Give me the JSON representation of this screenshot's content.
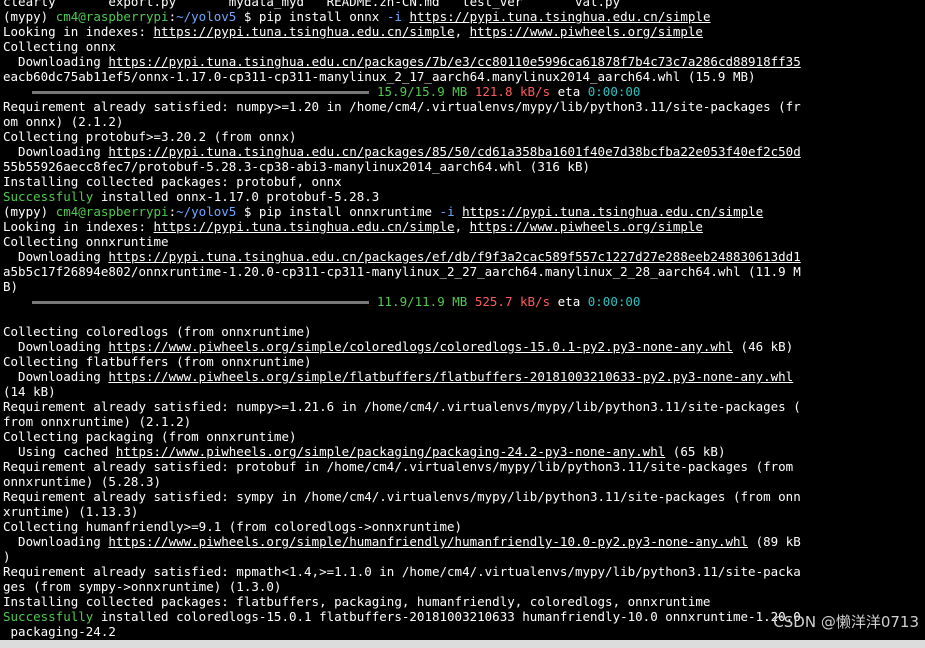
{
  "prompt": {
    "env": "(mypy)",
    "user_host": "cm4@raspberrypi",
    "path": "~/yolov5",
    "symbol": "$"
  },
  "top_partial": "clearly       export.py       mydata_myd   README.zh-CN.md   test_ver       val.py",
  "cmd1": {
    "text": "pip install onnx",
    "flag": "-i",
    "url": "https://pypi.tuna.tsinghua.edu.cn/simple"
  },
  "idx1": {
    "label": "Looking in indexes:",
    "url1": "https://pypi.tuna.tsinghua.edu.cn/simple",
    "url2": "https://www.piwheels.org/simple"
  },
  "l4": "Collecting onnx",
  "dl1": {
    "label": "  Downloading",
    "url": "https://pypi.tuna.tsinghua.edu.cn/packages/7b/e3/cc80110e5996ca61878f7b4c73c7a286cd88918ff35",
    "cont": "eacb60dc75ab11ef5/onnx-1.17.0-cp311-cp311-manylinux_2_17_aarch64.manylinux2014_aarch64.whl (15.9 MB)"
  },
  "prog1": {
    "size": "15.9/15.9 MB",
    "speed": "121.8 kB/s",
    "eta_label": "eta",
    "eta": "0:00:00"
  },
  "l8": "Requirement already satisfied: numpy>=1.20 in /home/cm4/.virtualenvs/mypy/lib/python3.11/site-packages (fr",
  "l9": "om onnx) (2.1.2)",
  "l10": "Collecting protobuf>=3.20.2 (from onnx)",
  "dl2": {
    "label": "  Downloading",
    "url": "https://pypi.tuna.tsinghua.edu.cn/packages/85/50/cd61a358ba1601f40e7d38bcfba22e053f40ef2c50d",
    "cont": "55b55926aecc8fec7/protobuf-5.28.3-cp38-abi3-manylinux2014_aarch64.whl (316 kB)"
  },
  "l13": "Installing collected packages: protobuf, onnx",
  "succ1": {
    "word": "Successfully",
    "rest": " installed onnx-1.17.0 protobuf-5.28.3"
  },
  "cmd2": {
    "text": "pip install onnxruntime",
    "flag": "-i",
    "url": "https://pypi.tuna.tsinghua.edu.cn/simple"
  },
  "l17": "Collecting onnxruntime",
  "dl3": {
    "label": "  Downloading",
    "url": "https://pypi.tuna.tsinghua.edu.cn/packages/ef/db/f9f3a2cac589f557c1227d27e288eeb248830613dd1",
    "cont": "a5b5c17f26894e802/onnxruntime-1.20.0-cp311-cp311-manylinux_2_27_aarch64.manylinux_2_28_aarch64.whl (11.9 M",
    "cont2": "B)"
  },
  "prog2": {
    "size": "11.9/11.9 MB",
    "speed": "525.7 kB/s",
    "eta_label": "eta",
    "eta": "0:00:00"
  },
  "l22": "Collecting coloredlogs (from onnxruntime)",
  "dl4": {
    "label": "  Downloading",
    "url": "https://www.piwheels.org/simple/coloredlogs/coloredlogs-15.0.1-py2.py3-none-any.whl",
    "size": " (46 kB)"
  },
  "l24": "Collecting flatbuffers (from onnxruntime)",
  "dl5": {
    "label": "  Downloading",
    "url": "https://www.piwheels.org/simple/flatbuffers/flatbuffers-20181003210633-py2.py3-none-any.whl",
    "size": "",
    "cont": "(14 kB)"
  },
  "l27": "Requirement already satisfied: numpy>=1.21.6 in /home/cm4/.virtualenvs/mypy/lib/python3.11/site-packages (",
  "l28": "from onnxruntime) (2.1.2)",
  "l29": "Collecting packaging (from onnxruntime)",
  "cached": {
    "label": "  Using cached",
    "url": "https://www.piwheels.org/simple/packaging/packaging-24.2-py3-none-any.whl",
    "size": " (65 kB)"
  },
  "l31": "Requirement already satisfied: protobuf in /home/cm4/.virtualenvs/mypy/lib/python3.11/site-packages (from",
  "l32": "onnxruntime) (5.28.3)",
  "l33": "Requirement already satisfied: sympy in /home/cm4/.virtualenvs/mypy/lib/python3.11/site-packages (from onn",
  "l34": "xruntime) (1.13.3)",
  "l35": "Collecting humanfriendly>=9.1 (from coloredlogs->onnxruntime)",
  "dl6": {
    "label": "  Downloading",
    "url": "https://www.piwheels.org/simple/humanfriendly/humanfriendly-10.0-py2.py3-none-any.whl",
    "size": " (89 kB",
    "cont": ")"
  },
  "l38": "Requirement already satisfied: mpmath<1.4,>=1.1.0 in /home/cm4/.virtualenvs/mypy/lib/python3.11/site-packa",
  "l39": "ges (from sympy->onnxruntime) (1.3.0)",
  "l40": "Installing collected packages: flatbuffers, packaging, humanfriendly, coloredlogs, onnxruntime",
  "succ2": {
    "word": "Successfully",
    "rest": " installed coloredlogs-15.0.1 flatbuffers-20181003210633 humanfriendly-10.0 onnxruntime-1.20.0",
    "cont": " packaging-24.2"
  },
  "watermark": "CSDN @懒洋洋0713",
  "colors": {
    "background": "#000000",
    "green": "#4ec94e",
    "blue": "#6fa8ff",
    "cyan": "#2bc1c1",
    "red": "#ff5a5a"
  }
}
